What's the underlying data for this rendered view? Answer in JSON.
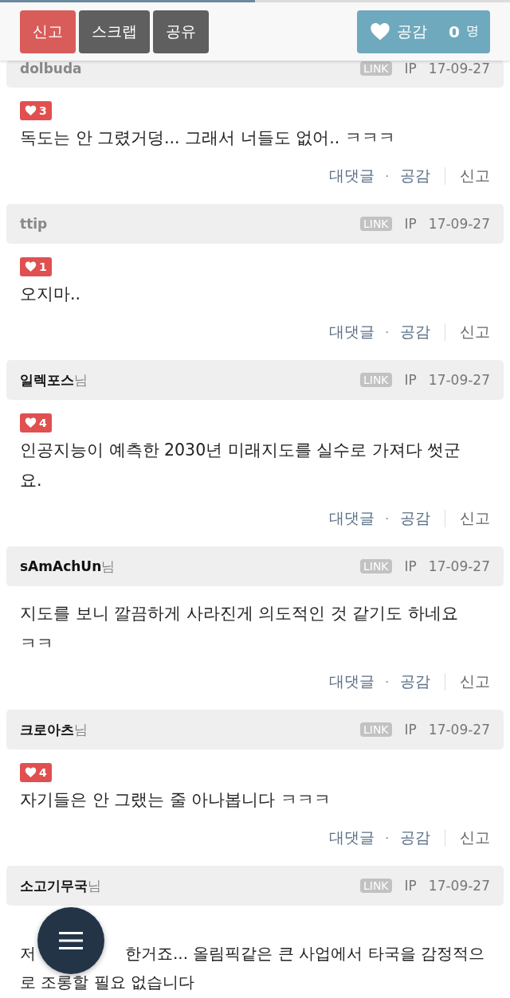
{
  "reading_progress": {
    "level": 0.5
  },
  "toolbar": {
    "buttons": [
      {
        "label": "신고",
        "kind": "report"
      },
      {
        "label": "스크랩",
        "kind": "plain"
      },
      {
        "label": "공유",
        "kind": "plain"
      }
    ],
    "like": {
      "label": "공감",
      "count": "0",
      "unit": "명"
    }
  },
  "comments": [
    {
      "name": "dolbuda",
      "member": false,
      "link": "LINK",
      "ip": "IP",
      "date": "17-09-27",
      "header_cut": true,
      "likes": "3",
      "text": [
        "독도는 안 그렸거덩... 그래서 너들도 없어.. ㅋㅋㅋ"
      ],
      "actions": {
        "reply": "대댓글",
        "separator": "·",
        "like": "공감",
        "report": "신고"
      }
    },
    {
      "name": "ttip",
      "member": false,
      "link": "LINK",
      "ip": "IP",
      "date": "17-09-27",
      "header_cut": false,
      "likes": "1",
      "text": [
        "오지마.."
      ],
      "actions": {
        "reply": "대댓글",
        "separator": "·",
        "like": "공감",
        "report": "신고"
      }
    },
    {
      "name": "일렉포스",
      "suffix": "님",
      "member": true,
      "link": "LINK",
      "ip": "IP",
      "date": "17-09-27",
      "header_cut": false,
      "likes": "4",
      "text": [
        "인공지능이 예측한 2030년 미래지도를 실수로 가져다 썻군요."
      ],
      "actions": {
        "reply": "대댓글",
        "separator": "·",
        "like": "공감",
        "report": "신고"
      }
    },
    {
      "name": "sAmAchUn",
      "suffix": "님",
      "member": true,
      "link": "LINK",
      "ip": "IP",
      "date": "17-09-27",
      "header_cut": false,
      "text": [
        "지도를 보니 깔끔하게 사라진게 의도적인 것 같기도 하네요 ㅋㅋ"
      ],
      "actions": {
        "reply": "대댓글",
        "separator": "·",
        "like": "공감",
        "report": "신고"
      }
    },
    {
      "name": "크로아츠",
      "suffix": "님",
      "member": true,
      "link": "LINK",
      "ip": "IP",
      "date": "17-09-27",
      "header_cut": false,
      "likes": "4",
      "text": [
        "자기들은 안 그랬는 줄 아나봅니다 ㅋㅋㅋ"
      ],
      "actions": {
        "reply": "대댓글",
        "separator": "·",
        "like": "공감",
        "report": "신고"
      }
    },
    {
      "name": "소고기무국",
      "suffix": "님",
      "member": true,
      "link": "LINK",
      "ip": "IP",
      "date": "17-09-27",
      "header_cut": false,
      "text": [
        "저",
        "한거죠... 올림픽같은 큰 사업에서 타국을 감정적으",
        "로 조롱할 필요 없습니다"
      ]
    }
  ]
}
